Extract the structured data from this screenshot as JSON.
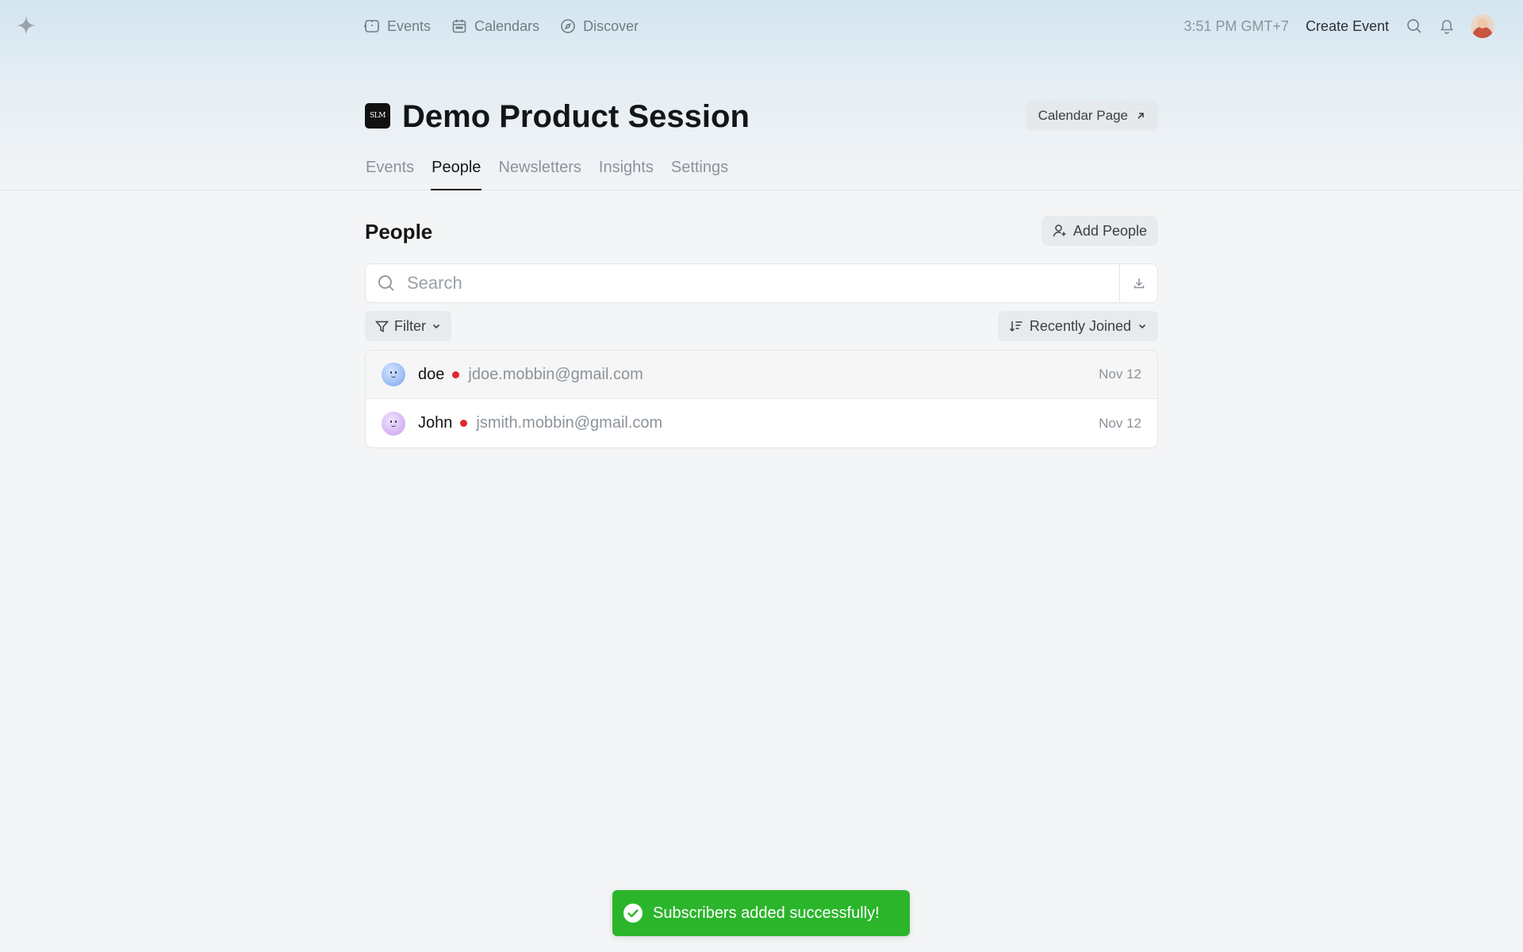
{
  "topnav": {
    "links": [
      {
        "label": "Events",
        "icon": "ticket-icon"
      },
      {
        "label": "Calendars",
        "icon": "calendar-icon"
      },
      {
        "label": "Discover",
        "icon": "compass-icon"
      }
    ],
    "clock": "3:51 PM GMT+7",
    "create_event": "Create Event"
  },
  "calendar": {
    "logo_text": "SLM",
    "title": "Demo Product Session",
    "calendar_page_label": "Calendar Page"
  },
  "tabs": [
    {
      "label": "Events",
      "active": false
    },
    {
      "label": "People",
      "active": true
    },
    {
      "label": "Newsletters",
      "active": false
    },
    {
      "label": "Insights",
      "active": false
    },
    {
      "label": "Settings",
      "active": false
    }
  ],
  "people": {
    "section_title": "People",
    "add_people_label": "Add People",
    "search_placeholder": "Search",
    "filter_label": "Filter",
    "sort_label": "Recently Joined",
    "rows": [
      {
        "name": "doe",
        "email": "jdoe.mobbin@gmail.com",
        "date": "Nov 12"
      },
      {
        "name": "John",
        "email": "jsmith.mobbin@gmail.com",
        "date": "Nov 12"
      }
    ]
  },
  "toast": {
    "message": "Subscribers added successfully!"
  },
  "colors": {
    "accent_toast": "#2bb52b",
    "status_dot": "#e0282e",
    "text_primary": "#131517",
    "text_muted": "#8b939b"
  }
}
